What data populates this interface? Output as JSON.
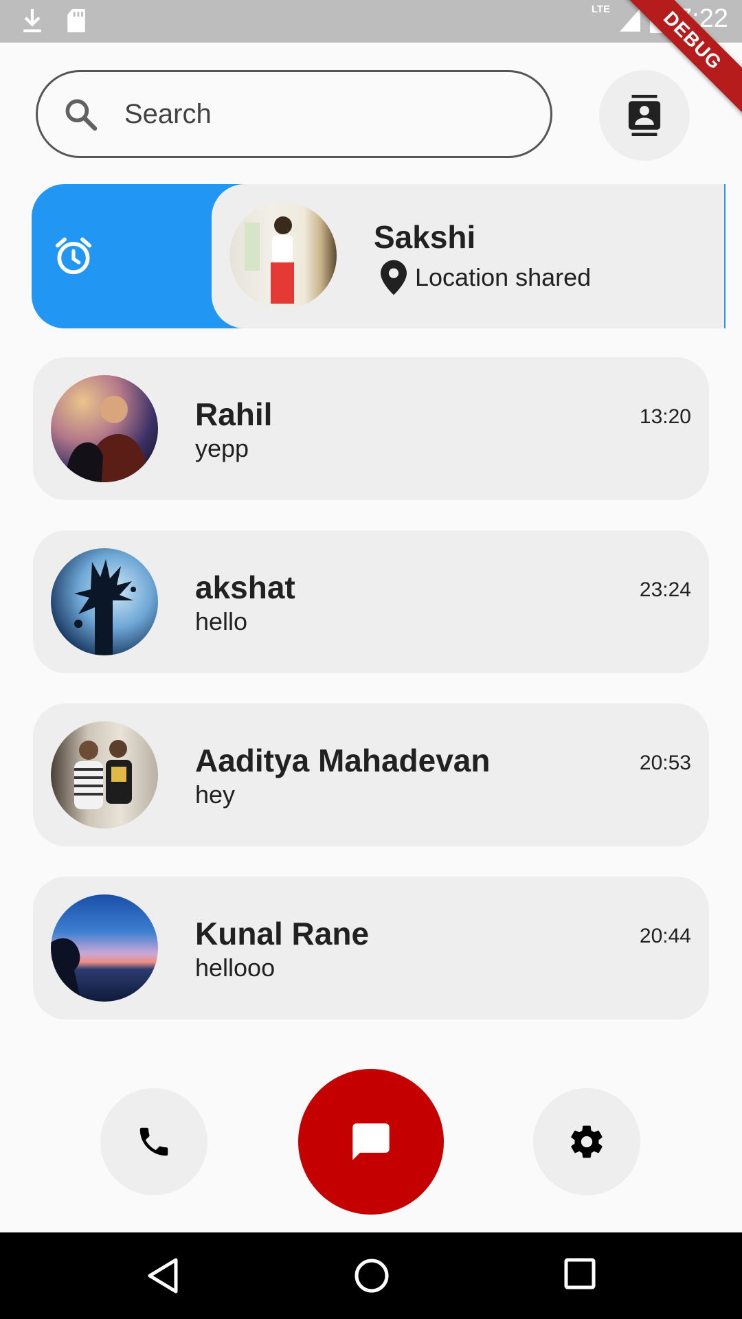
{
  "status_bar": {
    "time": "7:22",
    "network": "LTE",
    "debug_label": "DEBUG"
  },
  "search": {
    "placeholder": "Search"
  },
  "swiped_chat": {
    "name": "Sakshi",
    "subtitle": "Location shared",
    "action_icon": "alarm-icon",
    "action_color": "#2196f3"
  },
  "chats": [
    {
      "name": "Rahil",
      "message": "yepp",
      "time": "13:20"
    },
    {
      "name": "akshat",
      "message": "hello",
      "time": "23:24"
    },
    {
      "name": "Aaditya Mahadevan",
      "message": "hey",
      "time": "20:53"
    },
    {
      "name": "Kunal Rane",
      "message": "hellooo",
      "time": "20:44"
    }
  ],
  "bottom_nav": {
    "items": [
      "phone-icon",
      "chat-icon",
      "settings-icon"
    ],
    "active_color": "#c40000"
  },
  "colors": {
    "card_bg": "#eeeeee",
    "page_bg": "#fafafa"
  }
}
